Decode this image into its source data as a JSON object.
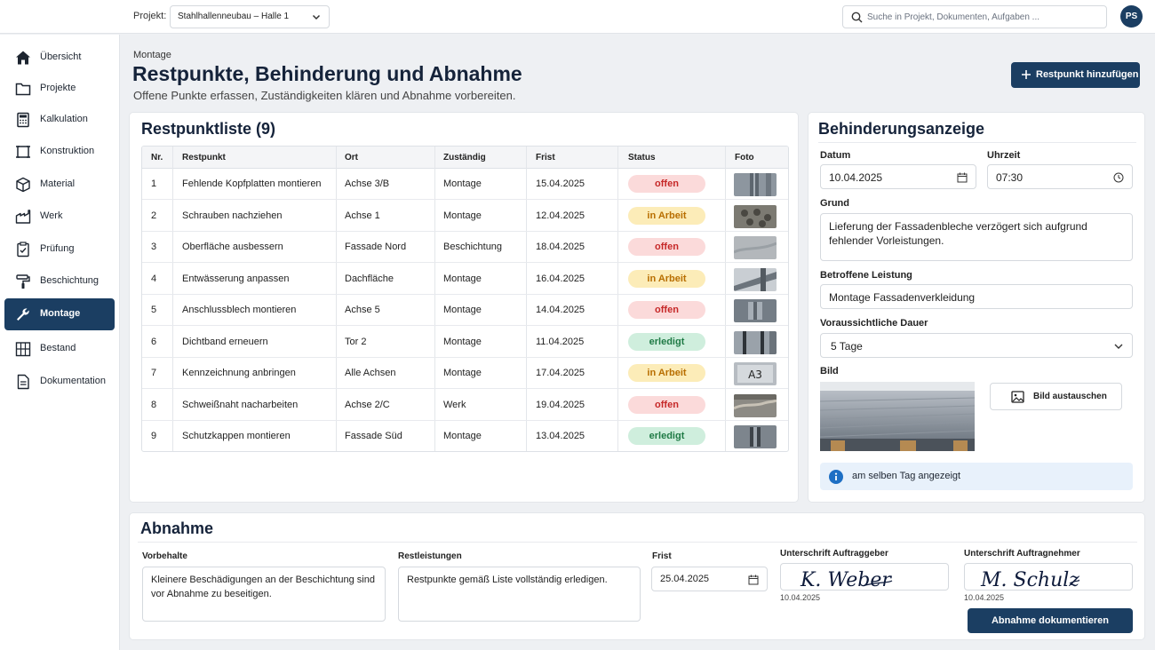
{
  "header": {
    "project_label": "Projekt:",
    "project_value": "Stahlhallenneubau – Halle 1",
    "search_placeholder": "Suche in Projekt, Dokumenten, Aufgaben ...",
    "avatar_initials": "PS"
  },
  "sidebar": {
    "items": [
      {
        "label": "Übersicht",
        "icon": "home-icon"
      },
      {
        "label": "Projekte",
        "icon": "folder-icon"
      },
      {
        "label": "Kalkulation",
        "icon": "calculator-icon"
      },
      {
        "label": "Konstruktion",
        "icon": "frame-icon"
      },
      {
        "label": "Material",
        "icon": "box-icon"
      },
      {
        "label": "Werk",
        "icon": "factory-icon"
      },
      {
        "label": "Prüfung",
        "icon": "clipboard-check-icon"
      },
      {
        "label": "Beschichtung",
        "icon": "paint-roller-icon"
      },
      {
        "label": "Montage",
        "icon": "wrench-icon",
        "active": true
      },
      {
        "label": "Bestand",
        "icon": "building-icon"
      },
      {
        "label": "Dokumentation",
        "icon": "document-icon"
      }
    ]
  },
  "page": {
    "breadcrumb": "Montage",
    "title": "Restpunkte, Behinderung und Abnahme",
    "subtitle": "Offene Punkte erfassen, Zuständigkeiten klären und Abnahme vorbereiten.",
    "add_button": "Restpunkt hinzufügen"
  },
  "restpunkte": {
    "title": "Restpunktliste (9)",
    "columns": [
      "Nr.",
      "Restpunkt",
      "Ort",
      "Zuständig",
      "Frist",
      "Status",
      "Foto"
    ],
    "rows": [
      {
        "nr": "1",
        "restpunkt": "Fehlende Kopfplatten montieren",
        "ort": "Achse 3/B",
        "zustaendig": "Montage",
        "frist": "15.04.2025",
        "status": "offen",
        "status_kind": "offen",
        "photo": "steel-profile"
      },
      {
        "nr": "2",
        "restpunkt": "Schrauben nachziehen",
        "ort": "Achse 1",
        "zustaendig": "Montage",
        "frist": "12.04.2025",
        "status": "in Arbeit",
        "status_kind": "arbeit",
        "photo": "bolts"
      },
      {
        "nr": "3",
        "restpunkt": "Oberfläche ausbessern",
        "ort": "Fassade Nord",
        "zustaendig": "Beschichtung",
        "frist": "18.04.2025",
        "status": "offen",
        "status_kind": "offen",
        "photo": "surface"
      },
      {
        "nr": "4",
        "restpunkt": "Entwässerung anpassen",
        "ort": "Dachfläche",
        "zustaendig": "Montage",
        "frist": "16.04.2025",
        "status": "in Arbeit",
        "status_kind": "arbeit",
        "photo": "gutter"
      },
      {
        "nr": "5",
        "restpunkt": "Anschlussblech montieren",
        "ort": "Achse 5",
        "zustaendig": "Montage",
        "frist": "14.04.2025",
        "status": "offen",
        "status_kind": "offen",
        "photo": "bracket"
      },
      {
        "nr": "6",
        "restpunkt": "Dichtband erneuern",
        "ort": "Tor 2",
        "zustaendig": "Montage",
        "frist": "11.04.2025",
        "status": "erledigt",
        "status_kind": "erledigt",
        "photo": "door-seal"
      },
      {
        "nr": "7",
        "restpunkt": "Kennzeichnung anbringen",
        "ort": "Alle Achsen",
        "zustaendig": "Montage",
        "frist": "17.04.2025",
        "status": "in Arbeit",
        "status_kind": "arbeit",
        "photo": "label",
        "photo_text": "A3"
      },
      {
        "nr": "8",
        "restpunkt": "Schweißnaht nacharbeiten",
        "ort": "Achse 2/C",
        "zustaendig": "Werk",
        "frist": "19.04.2025",
        "status": "offen",
        "status_kind": "offen",
        "photo": "weld"
      },
      {
        "nr": "9",
        "restpunkt": "Schutzkappen montieren",
        "ort": "Fassade Süd",
        "zustaendig": "Montage",
        "frist": "13.04.2025",
        "status": "erledigt",
        "status_kind": "erledigt",
        "photo": "cap"
      }
    ]
  },
  "behinderung": {
    "title": "Behinderungsanzeige",
    "datum_label": "Datum",
    "datum_value": "10.04.2025",
    "uhrzeit_label": "Uhrzeit",
    "uhrzeit_value": "07:30",
    "grund_label": "Grund",
    "grund_value": "Lieferung der Fassadenbleche verzögert sich aufgrund fehlender Vorleistungen.",
    "leistung_label": "Betroffene Leistung",
    "leistung_value": "Montage Fassadenverkleidung",
    "dauer_label": "Voraussichtliche Dauer",
    "dauer_value": "5 Tage",
    "bild_label": "Bild",
    "bild_button": "Bild austauschen",
    "info_text": "am selben Tag angezeigt"
  },
  "abnahme": {
    "title": "Abnahme",
    "vorbehalte_label": "Vorbehalte",
    "vorbehalte_value": "Kleinere Beschädigungen an der Beschichtung sind vor Abnahme zu beseitigen.",
    "rest_label": "Restleistungen",
    "rest_value": "Restpunkte gemäß Liste vollständig erledigen.",
    "frist_label": "Frist",
    "frist_value": "25.04.2025",
    "sig_ag_label": "Unterschrift Auftraggeber",
    "sig_ag_name": "K. Weber",
    "sig_ag_date": "10.04.2025",
    "sig_an_label": "Unterschrift Auftragnehmer",
    "sig_an_name": "M. Schulz",
    "sig_an_date": "10.04.2025",
    "doc_button": "Abnahme dokumentieren"
  },
  "colors": {
    "primary": "#1b3e62",
    "offen_bg": "#fbdada",
    "offen_fg": "#c62828",
    "arbeit_bg": "#fcecb8",
    "arbeit_fg": "#b86e00",
    "erledigt_bg": "#cfeedd",
    "erledigt_fg": "#1f7a45",
    "info_bg": "#e8f1fb"
  }
}
